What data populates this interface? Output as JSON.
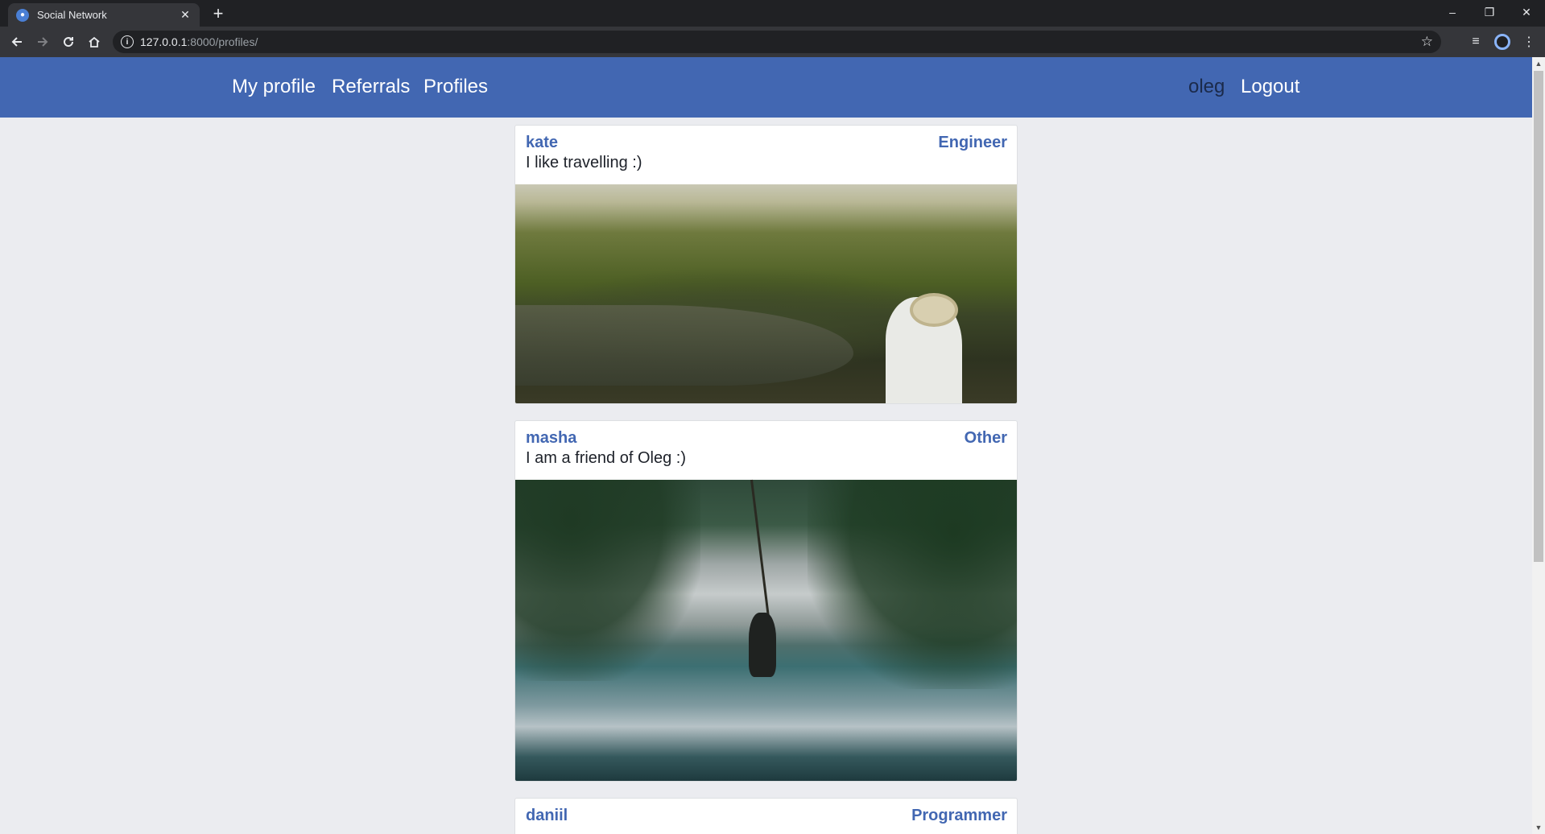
{
  "browser": {
    "tab_title": "Social Network",
    "tab_close": "✕",
    "new_tab": "+",
    "url_host": "127.0.0.1",
    "url_rest": ":8000/profiles/",
    "window_controls": {
      "minimize": "–",
      "restore": "❐",
      "close": "✕"
    }
  },
  "nav": {
    "left": [
      "My profile",
      "Referrals",
      "Profiles"
    ],
    "username": "oleg",
    "logout": "Logout",
    "header_color": "#4267b2"
  },
  "profiles": [
    {
      "name": "kate",
      "role": "Engineer",
      "bio": "I like travelling :)"
    },
    {
      "name": "masha",
      "role": "Other",
      "bio": "I am a friend of Oleg :)"
    },
    {
      "name": "daniil",
      "role": "Programmer",
      "bio": ""
    }
  ],
  "icons": {
    "back": "back-arrow-icon",
    "forward": "forward-arrow-icon",
    "reload": "reload-icon",
    "home": "home-icon",
    "info": "info-icon",
    "star": "star-icon",
    "media": "media-control-icon",
    "profile": "profile-icon",
    "menu": "menu-kebab-icon"
  }
}
